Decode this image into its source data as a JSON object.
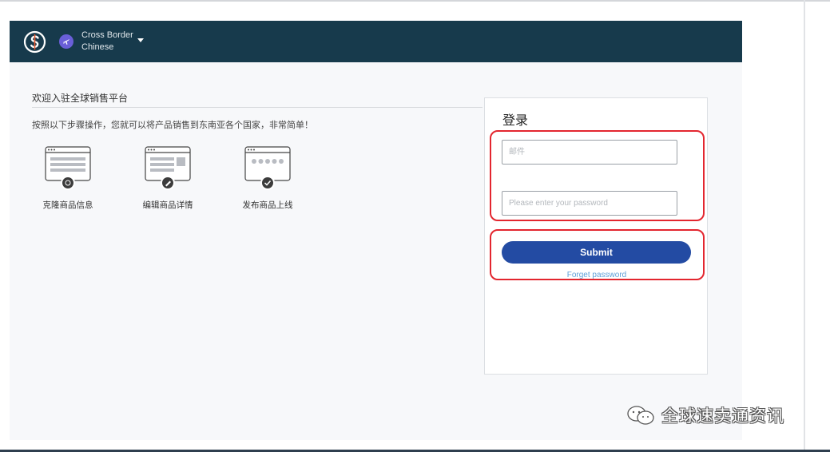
{
  "header": {
    "logo_icon": "s-logo-icon",
    "region_icon": "airplane-icon",
    "region_line1": "Cross Border",
    "region_line2": "Chinese",
    "dropdown_icon": "caret-down-icon"
  },
  "intro": {
    "title": "欢迎入驻全球销售平台",
    "instructions": "按照以下步骤操作，您就可以将产品销售到东南亚各个国家，非常简单！"
  },
  "steps": [
    {
      "label": "克隆商品信息",
      "icon": "clone-listing-icon"
    },
    {
      "label": "编辑商品详情",
      "icon": "edit-details-icon"
    },
    {
      "label": "发布商品上线",
      "icon": "publish-online-icon"
    }
  ],
  "login": {
    "title": "登录",
    "email_placeholder": "邮件",
    "password_placeholder": "Please enter your password",
    "submit_label": "Submit",
    "forgot_label": "Forget password"
  },
  "watermark": {
    "icon": "wechat-icon",
    "text": "全球速卖通资讯"
  },
  "colors": {
    "navbar": "#173a4c",
    "accent": "#234ba3",
    "link": "#5d9fd8",
    "highlight": "#e3262f",
    "region_badge": "#6a5fd8"
  }
}
